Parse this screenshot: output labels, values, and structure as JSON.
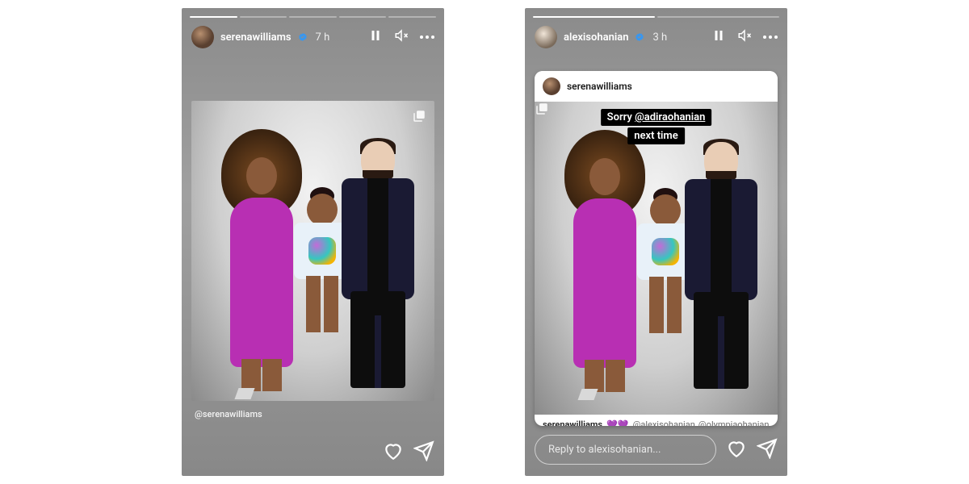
{
  "stories": {
    "left": {
      "username": "serenawilliams",
      "verified": true,
      "timestamp": "7 h",
      "tag": "@serenawilliams"
    },
    "right": {
      "username": "alexisohanian",
      "verified": true,
      "timestamp": "3 h",
      "reply_placeholder": "Reply to alexisohanian...",
      "repost": {
        "username": "serenawilliams",
        "caption_user": "serenawilliams",
        "caption_emoji": "💜💜",
        "mention1": "@alexisohanian",
        "mention2": "@olympiaohanian"
      },
      "overlay": {
        "line1_pre": "Sorry ",
        "line1_mention": "@adiraohanian",
        "line2": "next time"
      }
    }
  }
}
